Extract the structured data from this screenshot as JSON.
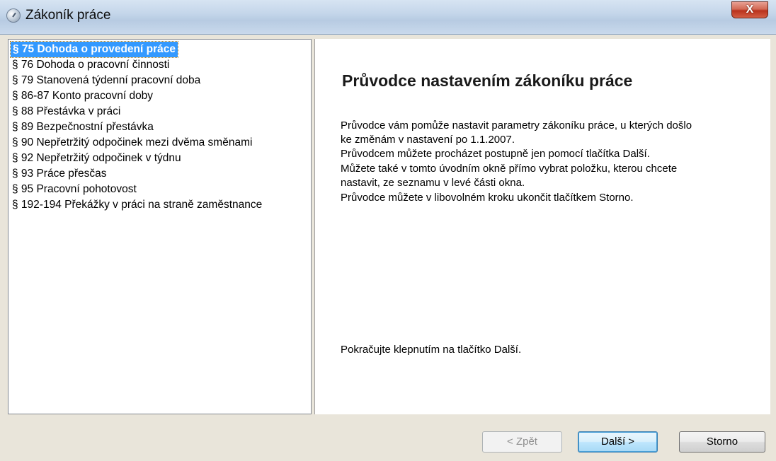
{
  "window": {
    "title": "Zákoník práce",
    "close_label": "X"
  },
  "nav_list": {
    "items": [
      {
        "label": "§ 75 Dohoda o provedení práce",
        "selected": true
      },
      {
        "label": "§ 76 Dohoda o pracovní činnosti"
      },
      {
        "label": "§ 79 Stanovená týdenní pracovní doba"
      },
      {
        "label": "§ 86-87 Konto pracovní doby"
      },
      {
        "label": "§ 88 Přestávka v práci"
      },
      {
        "label": "§ 89 Bezpečnostní přestávka"
      },
      {
        "label": "§ 90 Nepřetržitý odpočinek mezi dvěma směnami"
      },
      {
        "label": "§ 92 Nepřetržitý odpočinek v týdnu"
      },
      {
        "label": "§ 93 Práce přesčas"
      },
      {
        "label": "§ 95 Pracovní pohotovost"
      },
      {
        "label": "§ 192-194 Překážky v práci na straně zaměstnance"
      }
    ]
  },
  "content": {
    "heading": "Průvodce nastavením zákoníku práce",
    "intro_line1": "Průvodce vám pomůže nastavit parametry zákoníku práce, u kterých došlo",
    "intro_line2": "ke změnám v nastavení po 1.1.2007.",
    "intro_line3": "Průvodcem můžete procházet postupně jen pomocí tlačítka Další.",
    "intro_line4": "Můžete také v tomto úvodním okně přímo vybrat položku, kterou chcete",
    "intro_line5": "nastavit, ze seznamu v levé části okna.",
    "intro_line6": "Průvodce můžete v libovolném kroku ukončit tlačítkem Storno.",
    "footer_text": "Pokračujte klepnutím na tlačítko Další."
  },
  "buttons": {
    "back": "< Zpět",
    "next": "Další >",
    "cancel": "Storno"
  }
}
